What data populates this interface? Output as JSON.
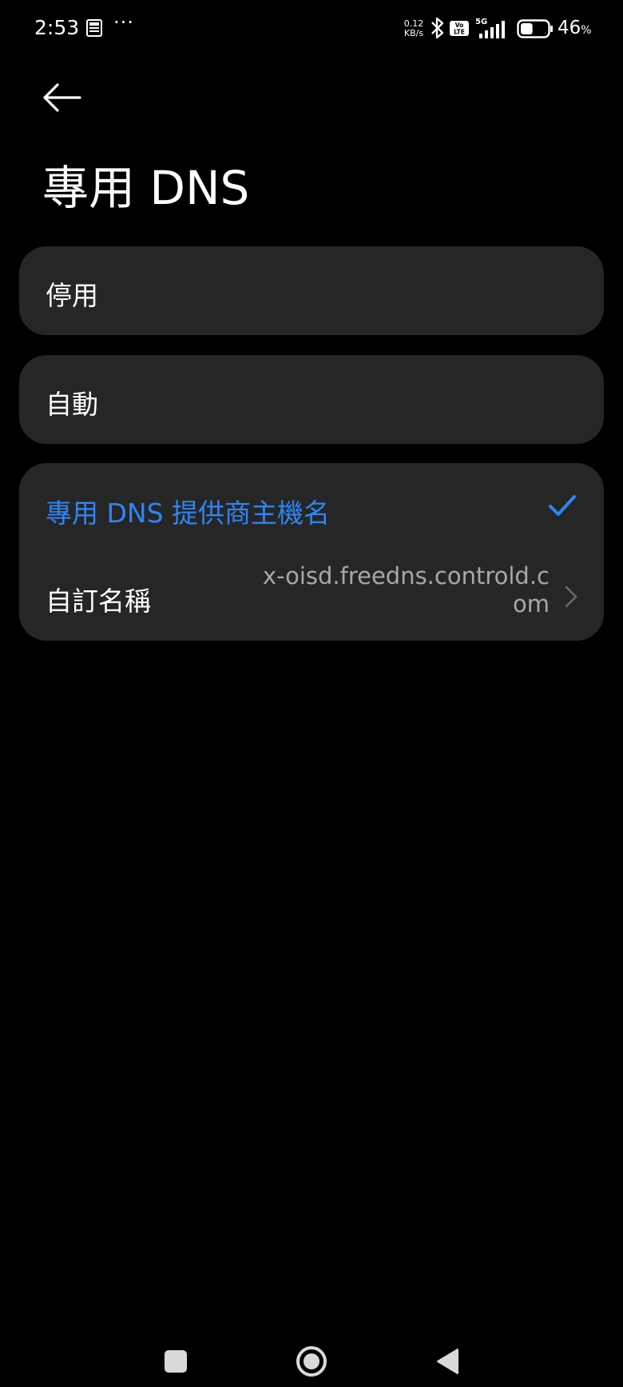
{
  "status_bar": {
    "time": "2:53",
    "dots": "···",
    "net_speed_value": "0.12",
    "net_speed_unit": "KB/s",
    "volte_line1": "Vo",
    "volte_line2": "LTE",
    "network_type": "5G",
    "battery_percent": "46",
    "battery_symbol": "%",
    "battery_level": 0.46
  },
  "header": {
    "title": "專用 DNS"
  },
  "options": {
    "off_label": "停用",
    "auto_label": "自動",
    "hostname_label": "專用 DNS 提供商主機名",
    "custom_label": "自訂名稱",
    "custom_value": "x-oisd.freedns.controld.com"
  },
  "colors": {
    "background": "#000000",
    "card": "#262626",
    "accent": "#2e86f6",
    "secondary_text": "#a8a8a8"
  },
  "icons": {
    "back": "arrow-left-icon",
    "selected": "check-icon",
    "more": "chevron-right-icon"
  }
}
